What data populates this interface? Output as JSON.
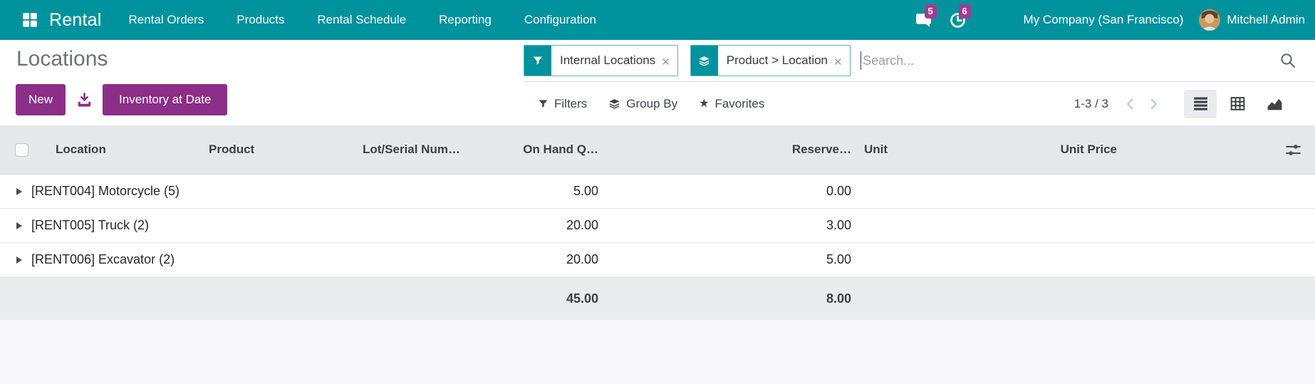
{
  "nav": {
    "brand": "Rental",
    "items": [
      "Rental Orders",
      "Products",
      "Rental Schedule",
      "Reporting",
      "Configuration"
    ],
    "messages_badge": "5",
    "activities_badge": "6",
    "company": "My Company (San Francisco)",
    "user": "Mitchell Admin"
  },
  "page": {
    "title": "Locations"
  },
  "actions": {
    "new_label": "New",
    "inventory_at_date_label": "Inventory at Date"
  },
  "search": {
    "placeholder": "Search...",
    "facets": [
      {
        "icon": "filter-funnel",
        "label": "Internal Locations"
      },
      {
        "icon": "group-by-layers",
        "label": "Product > Location"
      }
    ],
    "remove_glyph": "✕"
  },
  "controls": {
    "filters": "Filters",
    "group_by": "Group By",
    "favorites": "Favorites",
    "star_glyph": "★"
  },
  "pager": {
    "text": "1-3 / 3"
  },
  "view_switcher": [
    "list",
    "pivot",
    "graph"
  ],
  "table": {
    "columns": {
      "location": "Location",
      "product": "Product",
      "lot_serial": "Lot/Serial Num…",
      "on_hand": "On Hand Q…",
      "reserved": "Reserve…",
      "unit": "Unit",
      "unit_price": "Unit Price"
    },
    "groups": [
      {
        "name": "[RENT004] Motorcycle (5)",
        "on_hand": "5.00",
        "reserved": "0.00"
      },
      {
        "name": "[RENT005] Truck (2)",
        "on_hand": "20.00",
        "reserved": "3.00"
      },
      {
        "name": "[RENT006] Excavator (2)",
        "on_hand": "20.00",
        "reserved": "5.00"
      }
    ],
    "totals": {
      "on_hand": "45.00",
      "reserved": "8.00"
    }
  },
  "colors": {
    "navbar_teal": "#00929d",
    "button_purple": "#8b2e88",
    "badge_magenta": "#a23a93",
    "header_band": "#e6e9ec",
    "footer_band": "#e9eced"
  }
}
